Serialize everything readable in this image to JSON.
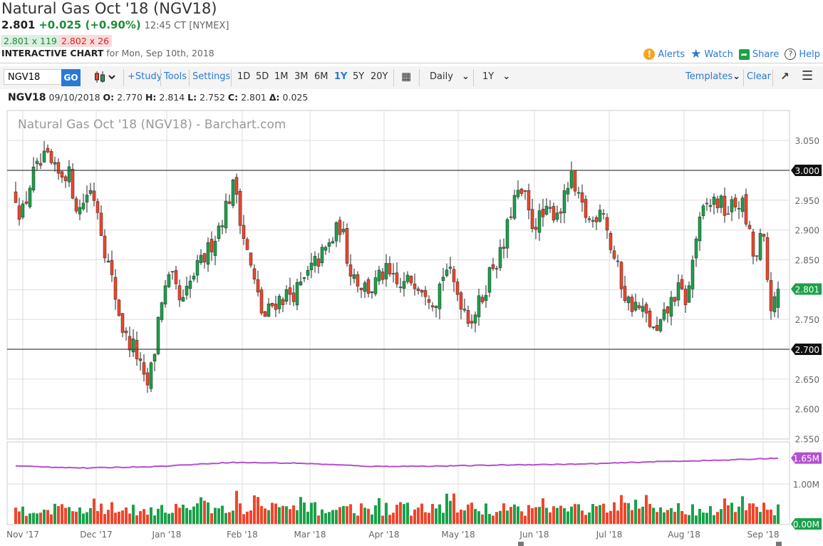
{
  "header": {
    "title": "Natural Gas Oct '18 (NGV18)",
    "last": "2.801",
    "change": "+0.025 (+0.90%)",
    "time": "12:45 CT [NYMEX]",
    "bid": "2.801 x 119",
    "ask": "2.802 x 26",
    "chart_label": "INTERACTIVE CHART",
    "chart_for": "for Mon, Sep 10th, 2018"
  },
  "actions": {
    "alerts": "Alerts",
    "watch": "Watch",
    "share": "Share",
    "help": "Help"
  },
  "toolbar": {
    "symbol_value": "NGV18",
    "go": "GO",
    "study": "+Study",
    "tools": "Tools",
    "settings": "Settings",
    "ranges": [
      "1D",
      "5D",
      "1M",
      "3M",
      "6M",
      "1Y",
      "5Y",
      "20Y"
    ],
    "active_range": "1Y",
    "interval": "Daily",
    "period": "1Y",
    "templates": "Templates",
    "clear": "Clear"
  },
  "ohlc": {
    "symbol": "NGV18",
    "date": "09/10/2018",
    "o_label": "O:",
    "o": "2.770",
    "h_label": "H:",
    "h": "2.814",
    "l_label": "L:",
    "l": "2.752",
    "c_label": "C:",
    "c": "2.801",
    "d_label": "Δ:",
    "d": "0.025"
  },
  "colors": {
    "up": "#1aa14a",
    "down": "#f0452b",
    "oi": "#b44fd0",
    "accent": "#2a7ad2"
  },
  "chart_data": {
    "type": "candlestick",
    "title": "Natural Gas Oct '18 (NGV18) - Barchart.com",
    "ylim": [
      2.55,
      3.05
    ],
    "y_ticks": [
      "3.050",
      "3.000",
      "2.950",
      "2.900",
      "2.850",
      "2.800",
      "2.750",
      "2.700",
      "2.650",
      "2.600",
      "2.550"
    ],
    "hlines": [
      {
        "value": 3.0,
        "label": "3.000"
      },
      {
        "value": 2.7,
        "label": "2.700"
      }
    ],
    "last_price": {
      "value": 2.801,
      "label": "2.801"
    },
    "last_bar": {
      "o": 2.77,
      "h": 2.814,
      "l": 2.752,
      "c": 2.801
    },
    "num_days": 215,
    "close_keypoints": [
      [
        0,
        2.96
      ],
      [
        1.6,
        2.92
      ],
      [
        4.6,
        2.99
      ],
      [
        8.6,
        3.02
      ],
      [
        11.6,
        2.99
      ],
      [
        14.6,
        3.0
      ],
      [
        17.6,
        2.93
      ],
      [
        20.6,
        2.97
      ],
      [
        22.6,
        2.95
      ],
      [
        25.6,
        2.85
      ],
      [
        27.6,
        2.8
      ],
      [
        30.6,
        2.72
      ],
      [
        33.6,
        2.7
      ],
      [
        36.6,
        2.63
      ],
      [
        38.6,
        2.68
      ],
      [
        40.6,
        2.78
      ],
      [
        43.6,
        2.82
      ],
      [
        46.6,
        2.77
      ],
      [
        49.6,
        2.82
      ],
      [
        53.6,
        2.86
      ],
      [
        56.6,
        2.9
      ],
      [
        59.6,
        2.95
      ],
      [
        61.6,
        2.98
      ],
      [
        63.6,
        2.9
      ],
      [
        66.6,
        2.82
      ],
      [
        69.6,
        2.75
      ],
      [
        72.6,
        2.78
      ],
      [
        75.6,
        2.79
      ],
      [
        79.6,
        2.8
      ],
      [
        83.6,
        2.84
      ],
      [
        87.6,
        2.87
      ],
      [
        91.2,
        2.91
      ],
      [
        93.6,
        2.84
      ],
      [
        96.6,
        2.81
      ],
      [
        99.6,
        2.8
      ],
      [
        103.6,
        2.83
      ],
      [
        107.6,
        2.8
      ],
      [
        111.6,
        2.82
      ],
      [
        115.6,
        2.8
      ],
      [
        117.6,
        2.78
      ],
      [
        120.6,
        2.84
      ],
      [
        123.6,
        2.8
      ],
      [
        127.6,
        2.75
      ],
      [
        130.6,
        2.78
      ],
      [
        133.6,
        2.84
      ],
      [
        136.6,
        2.86
      ],
      [
        139.6,
        2.95
      ],
      [
        142.6,
        2.96
      ],
      [
        144.6,
        2.91
      ],
      [
        147.6,
        2.92
      ],
      [
        150.6,
        2.93
      ],
      [
        153.6,
        2.94
      ],
      [
        155.6,
        2.99
      ],
      [
        157.6,
        2.95
      ],
      [
        161.6,
        2.91
      ],
      [
        164.6,
        2.95
      ],
      [
        166.6,
        2.88
      ],
      [
        168.6,
        2.84
      ],
      [
        171.6,
        2.78
      ],
      [
        174.6,
        2.77
      ],
      [
        177.6,
        2.75
      ],
      [
        179.6,
        2.72
      ],
      [
        182.6,
        2.76
      ],
      [
        185.6,
        2.8
      ],
      [
        188.6,
        2.78
      ],
      [
        190.6,
        2.88
      ],
      [
        193.6,
        2.94
      ],
      [
        196.6,
        2.95
      ],
      [
        199.6,
        2.93
      ],
      [
        203.6,
        2.95
      ],
      [
        205.6,
        2.9
      ],
      [
        207.6,
        2.84
      ],
      [
        209.6,
        2.9
      ],
      [
        211.6,
        2.78
      ],
      [
        213.2,
        2.77
      ],
      [
        214,
        2.801
      ]
    ],
    "months": [
      {
        "day": 2,
        "label": "Nov '17"
      },
      {
        "day": 22.6,
        "label": "Dec '17"
      },
      {
        "day": 42.4,
        "label": "Jan '18"
      },
      {
        "day": 63.6,
        "label": "Feb '18"
      },
      {
        "day": 82.6,
        "label": "Mar '18"
      },
      {
        "day": 103.4,
        "label": "Apr '18"
      },
      {
        "day": 124.2,
        "label": "May '18"
      },
      {
        "day": 145.6,
        "label": "Jun '18"
      },
      {
        "day": 166.6,
        "label": "Jul '18"
      },
      {
        "day": 187.6,
        "label": "Aug '18"
      },
      {
        "day": 209.8,
        "label": "Sep '18"
      }
    ],
    "volume": {
      "ylim_m": [
        0,
        2.05
      ],
      "y_ticks": [
        {
          "value": 1.0,
          "label": "1.00M"
        }
      ],
      "zero_label": "0.00M",
      "typical_range_m": [
        0.2,
        0.55
      ]
    },
    "open_interest": {
      "label": "1.65M",
      "value_m": 1.65,
      "keypoints_m": [
        [
          0,
          1.45
        ],
        [
          20,
          1.4
        ],
        [
          40,
          1.44
        ],
        [
          60,
          1.54
        ],
        [
          80,
          1.52
        ],
        [
          100,
          1.44
        ],
        [
          120,
          1.45
        ],
        [
          140,
          1.48
        ],
        [
          160,
          1.5
        ],
        [
          180,
          1.56
        ],
        [
          200,
          1.6
        ],
        [
          214,
          1.65
        ]
      ]
    }
  }
}
